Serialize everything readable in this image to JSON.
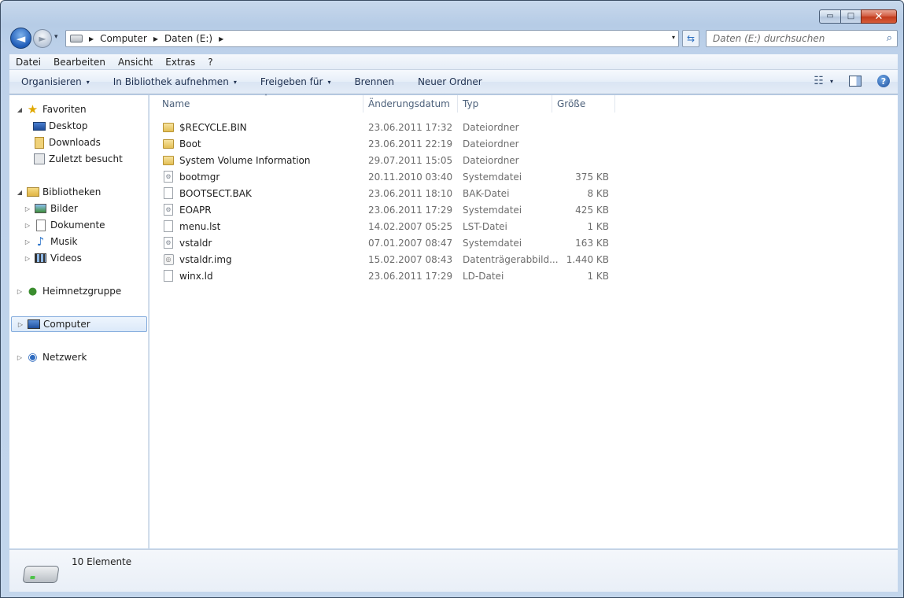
{
  "window": {
    "caption_buttons": {
      "minimize": "▭",
      "maximize": "□",
      "close": "✕"
    }
  },
  "nav": {
    "back_glyph": "◄",
    "forward_glyph": "►",
    "recent_glyph": "▾"
  },
  "address": {
    "crumbs": [
      "Computer",
      "Daten (E:)"
    ],
    "separator": "▶",
    "dropdown_glyph": "▾",
    "refresh_glyph": "⇆"
  },
  "search": {
    "placeholder": "Daten (E:) durchsuchen",
    "icon": "search-icon",
    "glyph": "⌕"
  },
  "menu": {
    "items": [
      "Datei",
      "Bearbeiten",
      "Ansicht",
      "Extras",
      "?"
    ]
  },
  "commands": {
    "organize": "Organisieren",
    "include_library": "In Bibliothek aufnehmen",
    "share": "Freigeben für",
    "burn": "Brennen",
    "new_folder": "Neuer Ordner",
    "dropdown_glyph": "▾",
    "views_glyph": "☷",
    "help_glyph": "?"
  },
  "sidebar": {
    "favorites": {
      "label": "Favoriten",
      "items": [
        {
          "label": "Desktop",
          "icon": "desktop-icon"
        },
        {
          "label": "Downloads",
          "icon": "downloads-icon"
        },
        {
          "label": "Zuletzt besucht",
          "icon": "recent-places-icon"
        }
      ]
    },
    "libraries": {
      "label": "Bibliotheken",
      "items": [
        {
          "label": "Bilder",
          "icon": "pictures-icon"
        },
        {
          "label": "Dokumente",
          "icon": "documents-icon"
        },
        {
          "label": "Musik",
          "icon": "music-icon"
        },
        {
          "label": "Videos",
          "icon": "videos-icon"
        }
      ]
    },
    "homegroup": {
      "label": "Heimnetzgruppe"
    },
    "computer": {
      "label": "Computer",
      "selected": true
    },
    "network": {
      "label": "Netzwerk"
    },
    "expanded_glyph": "◢",
    "collapsed_glyph": "▷"
  },
  "file_list": {
    "columns": {
      "name": "Name",
      "date": "Änderungsdatum",
      "type": "Typ",
      "size": "Größe"
    },
    "sort_glyph": "˄",
    "rows": [
      {
        "name": "$RECYCLE.BIN",
        "date": "23.06.2011 17:32",
        "type": "Dateiordner",
        "size": "",
        "icon": "folder-icon"
      },
      {
        "name": "Boot",
        "date": "23.06.2011 22:19",
        "type": "Dateiordner",
        "size": "",
        "icon": "folder-icon"
      },
      {
        "name": "System Volume Information",
        "date": "29.07.2011 15:05",
        "type": "Dateiordner",
        "size": "",
        "icon": "folder-icon"
      },
      {
        "name": "bootmgr",
        "date": "20.11.2010 03:40",
        "type": "Systemdatei",
        "size": "375 KB",
        "icon": "system-file-icon"
      },
      {
        "name": "BOOTSECT.BAK",
        "date": "23.06.2011 18:10",
        "type": "BAK-Datei",
        "size": "8 KB",
        "icon": "file-icon"
      },
      {
        "name": "EOAPR",
        "date": "23.06.2011 17:29",
        "type": "Systemdatei",
        "size": "425 KB",
        "icon": "system-file-icon"
      },
      {
        "name": "menu.lst",
        "date": "14.02.2007 05:25",
        "type": "LST-Datei",
        "size": "1 KB",
        "icon": "file-icon"
      },
      {
        "name": "vstaldr",
        "date": "07.01.2007 08:47",
        "type": "Systemdatei",
        "size": "163 KB",
        "icon": "system-file-icon"
      },
      {
        "name": "vstaldr.img",
        "date": "15.02.2007 08:43",
        "type": "Datenträgerabbild...",
        "size": "1.440 KB",
        "icon": "disc-image-icon"
      },
      {
        "name": "winx.ld",
        "date": "23.06.2011 17:29",
        "type": "LD-Datei",
        "size": "1 KB",
        "icon": "file-icon"
      }
    ]
  },
  "details": {
    "item_count": "10 Elemente",
    "icon": "drive-icon"
  }
}
